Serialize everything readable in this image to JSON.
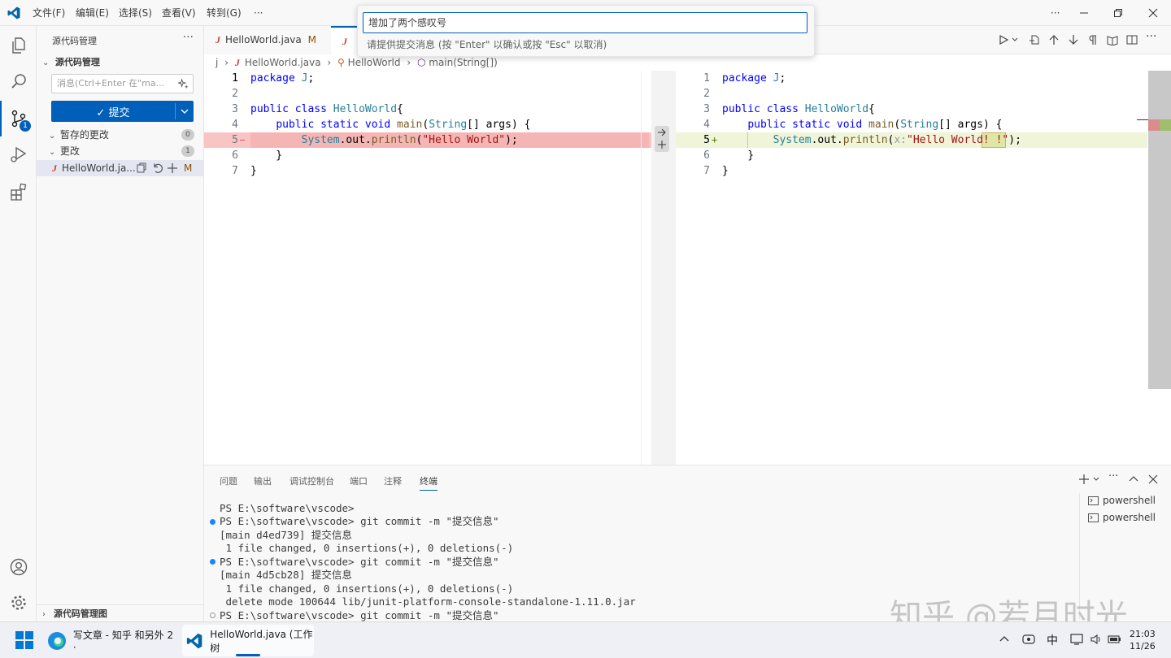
{
  "titlebar": {
    "menus": [
      "文件(F)",
      "编辑(E)",
      "选择(S)",
      "查看(V)",
      "转到(G)",
      "···"
    ],
    "overflow": "···"
  },
  "activity": {
    "scm_badge": "1"
  },
  "sidebar": {
    "title": "源代码管理",
    "more": "···",
    "section_title": "源代码管理",
    "message_placeholder": "消息(Ctrl+Enter 在\"ma...",
    "commit_label": "✓ 提交",
    "staged_label": "暂存的更改",
    "staged_count": "0",
    "changes_label": "更改",
    "changes_count": "1",
    "file_name": "HelloWorld.ja...",
    "file_status": "M",
    "graph_label": "源代码管理图"
  },
  "tabs": [
    {
      "label": "HelloWorld.java",
      "status": "M"
    }
  ],
  "breadcrumb": {
    "root": "j",
    "file": "HelloWorld.java",
    "class": "HelloWorld",
    "method": "main(String[])"
  },
  "quickinput": {
    "value": "增加了两个感叹号",
    "description": "请提供提交消息 (按 \"Enter\" 以确认或按 \"Esc\" 以取消)"
  },
  "editor_left": {
    "line_numbers": [
      "1",
      "2",
      "3",
      "4",
      "5",
      "6",
      "7"
    ],
    "removed_marker": "—"
  },
  "editor_right": {
    "line_numbers": [
      "1",
      "2",
      "3",
      "4",
      "5",
      "6",
      "7"
    ],
    "added_marker": "+"
  },
  "panel": {
    "tabs": [
      "问题",
      "输出",
      "调试控制台",
      "端口",
      "注释",
      "终端"
    ],
    "terminal_lines": [
      "PS E:\\software\\vscode>",
      "PS E:\\software\\vscode> git commit -m \"提交信息\"",
      "[main d4ed739] 提交信息",
      " 1 file changed, 0 insertions(+), 0 deletions(-)",
      "PS E:\\software\\vscode> git commit -m \"提交信息\"",
      "[main 4d5cb28] 提交信息",
      " 1 file changed, 0 insertions(+), 0 deletions(-)",
      " delete mode 100644 lib/junit-platform-console-standalone-1.11.0.jar",
      "PS E:\\software\\vscode> git commit -m \"提交信息\""
    ],
    "shells": [
      "powershell",
      "powershell"
    ]
  },
  "watermark": "知乎 @若月时光",
  "taskbar": {
    "apps": [
      "写文章 - 知乎 和另外 2 ·",
      "HelloWorld.java (工作树"
    ],
    "ime": "中",
    "time": "21:03",
    "date": "11/26"
  },
  "colors": {
    "accent": "#005fb8",
    "removed_bg": "#f9c4c4",
    "added_bg": "#f0f4d8"
  }
}
